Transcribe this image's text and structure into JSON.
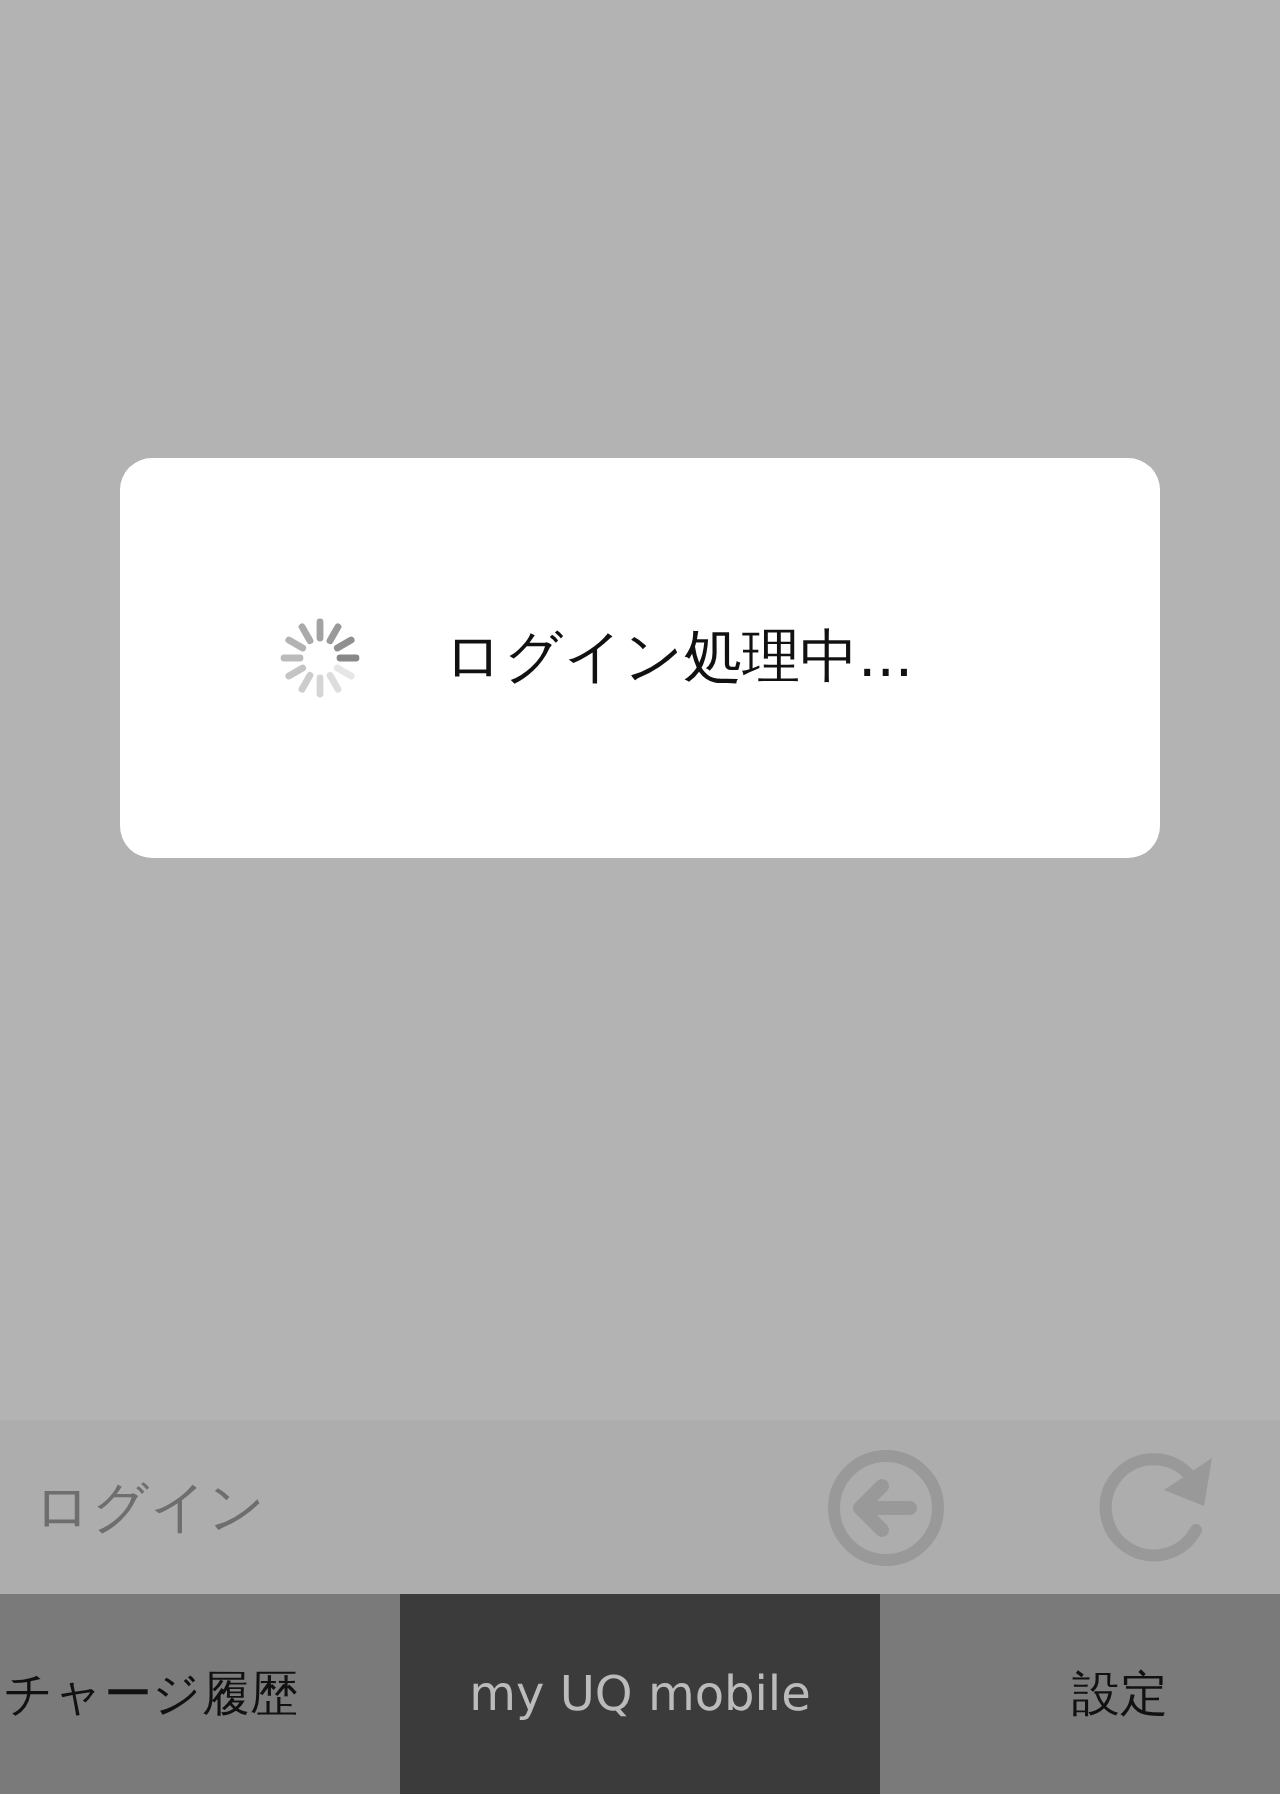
{
  "dialog": {
    "message": "ログイン処理中..."
  },
  "toolbar": {
    "title": "ログイン"
  },
  "tabs": [
    {
      "label": "チャージ履歴",
      "selected": false
    },
    {
      "label": "my UQ mobile",
      "selected": true
    },
    {
      "label": "設定",
      "selected": false
    }
  ]
}
